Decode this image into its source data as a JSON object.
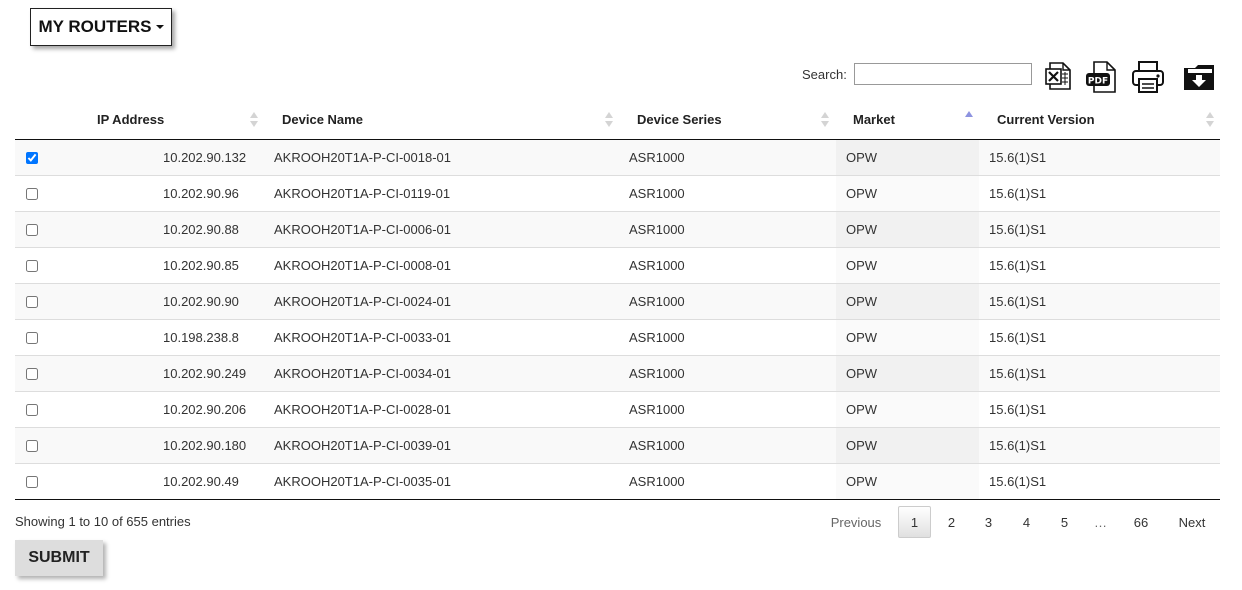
{
  "routers_menu": {
    "label": "MY ROUTERS"
  },
  "search": {
    "label": "Search:",
    "value": ""
  },
  "export_icons": [
    "excel-icon",
    "pdf-icon",
    "print-icon",
    "download-icon"
  ],
  "table": {
    "columns": [
      "IP Address",
      "Device Name",
      "Device Series",
      "Market",
      "Current Version"
    ],
    "sorted_column": "Market",
    "sort_direction": "ascending",
    "rows": [
      {
        "checked": true,
        "ip": "10.202.90.132",
        "device": "AKROOH20T1A-P-CI-0018-01",
        "series": "ASR1000",
        "market": "OPW",
        "version": "15.6(1)S1"
      },
      {
        "checked": false,
        "ip": "10.202.90.96",
        "device": "AKROOH20T1A-P-CI-0119-01",
        "series": "ASR1000",
        "market": "OPW",
        "version": "15.6(1)S1"
      },
      {
        "checked": false,
        "ip": "10.202.90.88",
        "device": "AKROOH20T1A-P-CI-0006-01",
        "series": "ASR1000",
        "market": "OPW",
        "version": "15.6(1)S1"
      },
      {
        "checked": false,
        "ip": "10.202.90.85",
        "device": "AKROOH20T1A-P-CI-0008-01",
        "series": "ASR1000",
        "market": "OPW",
        "version": "15.6(1)S1"
      },
      {
        "checked": false,
        "ip": "10.202.90.90",
        "device": "AKROOH20T1A-P-CI-0024-01",
        "series": "ASR1000",
        "market": "OPW",
        "version": "15.6(1)S1"
      },
      {
        "checked": false,
        "ip": "10.198.238.8",
        "device": "AKROOH20T1A-P-CI-0033-01",
        "series": "ASR1000",
        "market": "OPW",
        "version": "15.6(1)S1"
      },
      {
        "checked": false,
        "ip": "10.202.90.249",
        "device": "AKROOH20T1A-P-CI-0034-01",
        "series": "ASR1000",
        "market": "OPW",
        "version": "15.6(1)S1"
      },
      {
        "checked": false,
        "ip": "10.202.90.206",
        "device": "AKROOH20T1A-P-CI-0028-01",
        "series": "ASR1000",
        "market": "OPW",
        "version": "15.6(1)S1"
      },
      {
        "checked": false,
        "ip": "10.202.90.180",
        "device": "AKROOH20T1A-P-CI-0039-01",
        "series": "ASR1000",
        "market": "OPW",
        "version": "15.6(1)S1"
      },
      {
        "checked": false,
        "ip": "10.202.90.49",
        "device": "AKROOH20T1A-P-CI-0035-01",
        "series": "ASR1000",
        "market": "OPW",
        "version": "15.6(1)S1"
      }
    ]
  },
  "footer": {
    "info": "Showing 1 to 10 of 655 entries",
    "pagination": {
      "previous": "Previous",
      "pages": [
        "1",
        "2",
        "3",
        "4",
        "5",
        "…",
        "66"
      ],
      "current": "1",
      "next": "Next"
    },
    "submit": "SUBMIT"
  },
  "colors": {
    "sort_active": "#8d93e0",
    "stripe": "#f9f9f9",
    "sorted_column": "#f1f1f1"
  }
}
